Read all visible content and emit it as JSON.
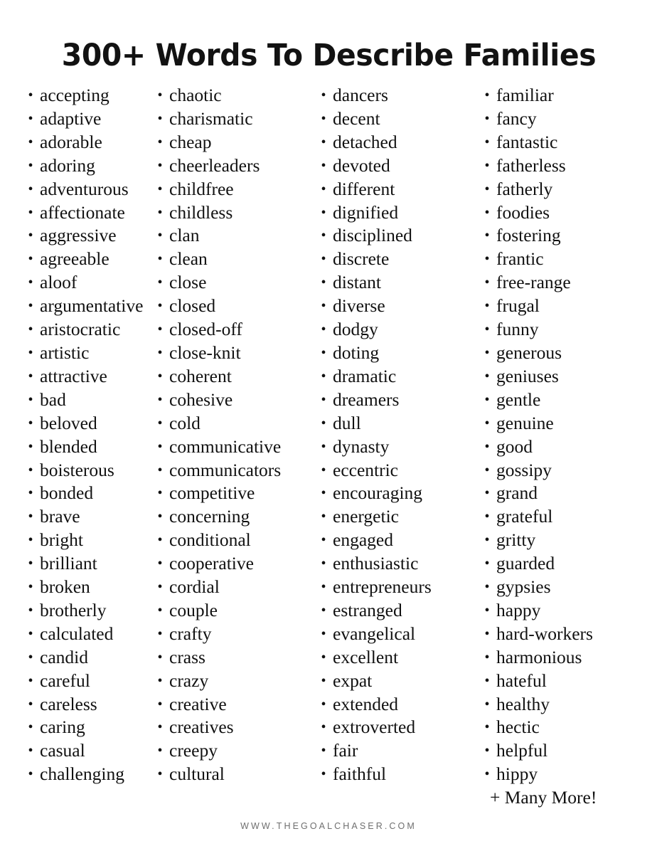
{
  "page": {
    "background_color": "#ffffff",
    "text_color": "#111111"
  },
  "header": {
    "title": "300+ Words To Describe Families"
  },
  "list": {
    "bullet_glyph": "•",
    "columns": [
      {
        "name": "column-1",
        "items": [
          "accepting",
          "adaptive",
          "adorable",
          "adoring",
          "adventurous",
          "affectionate",
          "aggressive",
          "agreeable",
          "aloof",
          "argumentative",
          "aristocratic",
          "artistic",
          "attractive",
          "bad",
          "beloved",
          "blended",
          "boisterous",
          "bonded",
          "brave",
          "bright",
          "brilliant",
          "broken",
          "brotherly",
          "calculated",
          "candid",
          "careful",
          "careless",
          "caring",
          "casual",
          "challenging"
        ]
      },
      {
        "name": "column-2",
        "items": [
          "chaotic",
          "charismatic",
          "cheap",
          "cheerleaders",
          "childfree",
          "childless",
          "clan",
          "clean",
          "close",
          "closed",
          "closed-off",
          "close-knit",
          "coherent",
          "cohesive",
          "cold",
          "communicative",
          "communicators",
          "competitive",
          "concerning",
          "conditional",
          "cooperative",
          "cordial",
          "couple",
          "crafty",
          "crass",
          "crazy",
          "creative",
          "creatives",
          "creepy",
          "cultural"
        ]
      },
      {
        "name": "column-3",
        "items": [
          "dancers",
          "decent",
          "detached",
          "devoted",
          "different",
          "dignified",
          "disciplined",
          "discrete",
          "distant",
          "diverse",
          "dodgy",
          "doting",
          "dramatic",
          "dreamers",
          "dull",
          "dynasty",
          "eccentric",
          "encouraging",
          "energetic",
          "engaged",
          "enthusiastic",
          "entrepreneurs",
          "estranged",
          "evangelical",
          "excellent",
          "expat",
          "extended",
          "extroverted",
          "fair",
          "faithful"
        ]
      },
      {
        "name": "column-4",
        "items": [
          "familiar",
          "fancy",
          "fantastic",
          "fatherless",
          "fatherly",
          "foodies",
          "fostering",
          "frantic",
          "free-range",
          "frugal",
          "funny",
          "generous",
          "geniuses",
          "gentle",
          "genuine",
          "good",
          "gossipy",
          "grand",
          "grateful",
          "gritty",
          "guarded",
          "gypsies",
          "happy",
          "hard-workers",
          "harmonious",
          "hateful",
          "healthy",
          "hectic",
          "helpful",
          "hippy"
        ],
        "trailing_note": "+ Many More!"
      }
    ]
  },
  "footer": {
    "website": "WWW.THEGOALCHASER.COM",
    "color": "#6f6f6f"
  }
}
